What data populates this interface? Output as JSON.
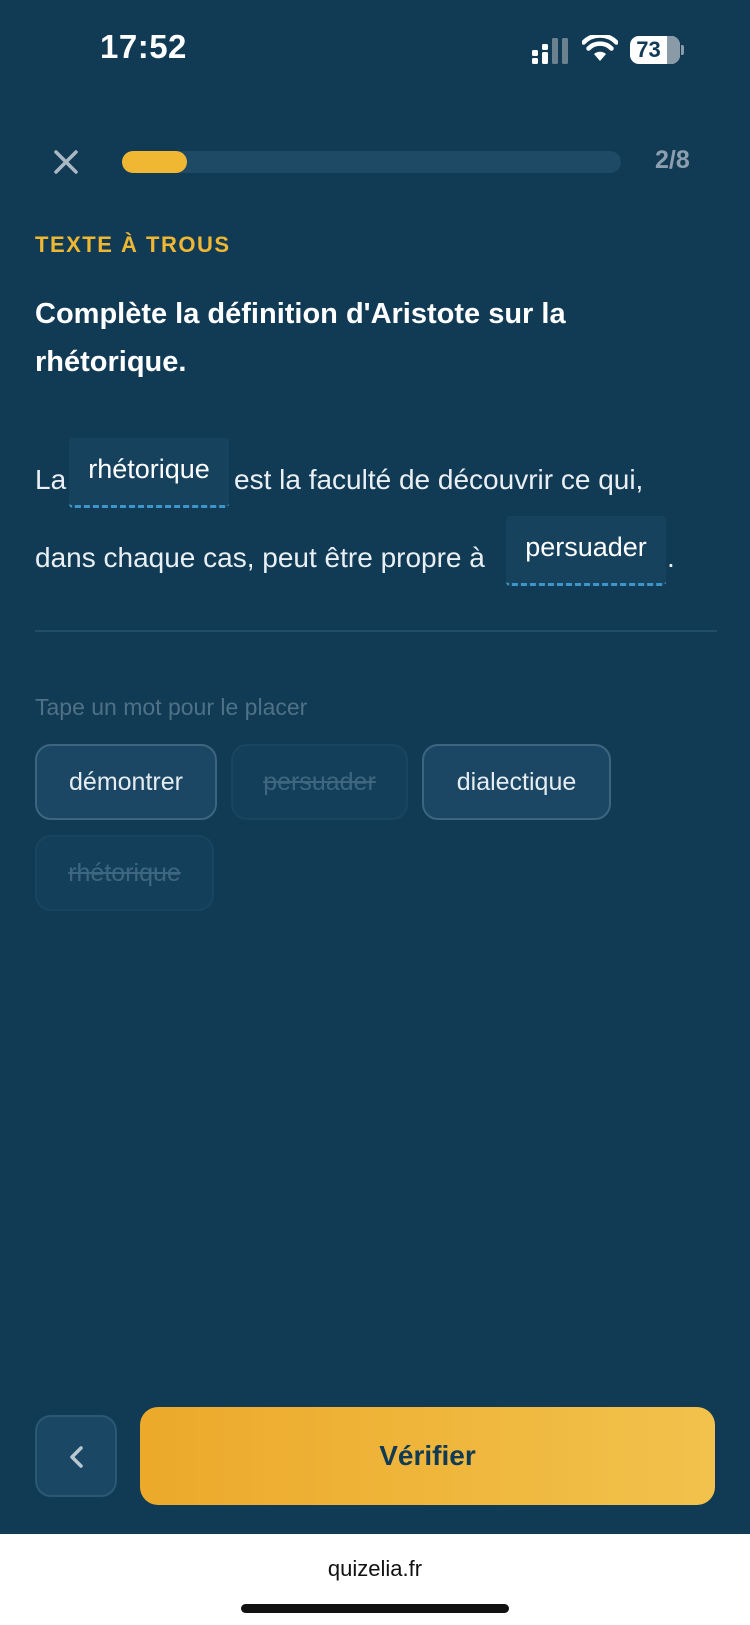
{
  "status_bar": {
    "time": "17:52",
    "battery": "73",
    "battery_level": 0.73
  },
  "header": {
    "progress": 0.13,
    "counter": "2/8"
  },
  "question": {
    "type_label": "TEXTE À TROUS",
    "prompt": "Complète la définition d'Aristote sur la rhétorique.",
    "sentence": {
      "part1": "La",
      "blank1": "rhétorique",
      "part2": "est la faculté de découvrir ce qui,",
      "part3": "dans chaque cas, peut être propre à",
      "blank2": "persuader",
      "part4": "."
    }
  },
  "word_bank": {
    "hint": "Tape un mot pour le placer",
    "chips": [
      {
        "label": "démontrer",
        "used": false
      },
      {
        "label": "persuader",
        "used": true
      },
      {
        "label": "dialectique",
        "used": false
      },
      {
        "label": "rhétorique",
        "used": true
      }
    ]
  },
  "footer": {
    "verify_label": "Vérifier"
  },
  "browser": {
    "url": "quizelia.fr"
  },
  "colors": {
    "background": "#113a55",
    "accent": "#f0b732",
    "blank_underline": "#3d95c9"
  }
}
